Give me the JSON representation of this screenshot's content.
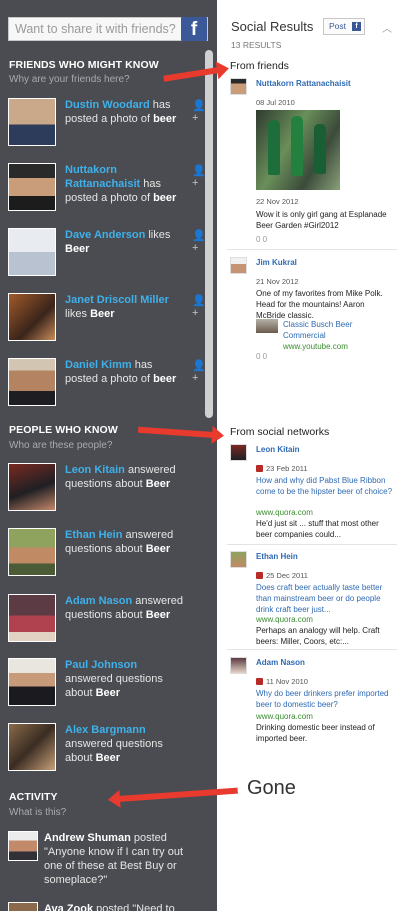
{
  "left": {
    "share_placeholder": "Want to share it with friends?",
    "fb_glyph": "f",
    "friends_title": "FRIENDS WHO MIGHT KNOW",
    "friends_sub": "Why are your friends here?",
    "friends": [
      {
        "name": "Dustin Woodard",
        "action": " has posted a photo of ",
        "topic": "beer",
        "img_color": "#5f7a4a"
      },
      {
        "name": "Nuttakorn Rattanachaisit",
        "action": " has posted a photo of ",
        "topic": "beer",
        "img_color": "#3b3d3d"
      },
      {
        "name": "Dave Anderson",
        "action": " likes ",
        "topic": "Beer",
        "img_color": "#d7dbe0"
      },
      {
        "name": "Janet Driscoll Miller",
        "action": " likes ",
        "topic": "Beer",
        "img_color": "#7a5d3b"
      },
      {
        "name": "Daniel Kimm",
        "action": " has posted a photo of ",
        "topic": "beer",
        "img_color": "#8b7e6a"
      }
    ],
    "people_title": "PEOPLE WHO KNOW",
    "people_sub": "Who are these people?",
    "people": [
      {
        "name": "Leon Kitain",
        "action": " answered questions about ",
        "topic": "Beer",
        "img_color": "#6b3d2e"
      },
      {
        "name": "Ethan Hein",
        "action": " answered questions about ",
        "topic": "Beer",
        "img_color": "#7e8a52"
      },
      {
        "name": "Adam Nason",
        "action": " answered questions about ",
        "topic": "Beer",
        "img_color": "#8a3340"
      },
      {
        "name": "Paul Johnson",
        "action": " answered questions about ",
        "topic": "Beer",
        "img_color": "#2e2e33"
      },
      {
        "name": "Alex Bargmann",
        "action": " answered questions about ",
        "topic": "Beer",
        "img_color": "#6a5440"
      }
    ],
    "activity_title": "ACTIVITY",
    "activity_sub": "What is this?",
    "activity": [
      {
        "name": "Andrew Shuman",
        "text": " posted \"Anyone know if I can try out one of these at Best Buy or someplace?\""
      },
      {
        "name": "Ava Zook",
        "text": " posted \"Need to"
      }
    ]
  },
  "right": {
    "title": "Social Results",
    "count": "13 RESULTS",
    "post_label": "Post",
    "from_friends": "From friends",
    "friend_cards": [
      {
        "name": "Nuttakorn Rattanachaisit",
        "date": "08 Jul 2010",
        "photo_date": "22 Nov 2012",
        "text": "Wow it is only girl gang at Esplanade Beer Garden #Girl2012",
        "counts": "0  0"
      },
      {
        "name": "Jim Kukral",
        "date": "21 Nov 2012",
        "text": "One of my favorites from Mike Polk. Head for the mountains! Aaron McBride classic.",
        "link": "Classic Busch Beer Commercial",
        "url": "www.youtube.com",
        "counts": "0  0"
      }
    ],
    "from_networks": "From social networks",
    "network_cards": [
      {
        "name": "Leon Kitain",
        "date": "23 Feb 2011",
        "question": "How and why did Pabst Blue Ribbon come to be the hipster beer of choice?",
        "url": "www.quora.com",
        "snippet": "He'd just sit ... stuff that most other beer companies could..."
      },
      {
        "name": "Ethan Hein",
        "date": "25 Dec 2011",
        "question": "Does craft beer actually taste better than mainstream beer or do people drink craft beer just...",
        "url": "www.quora.com",
        "snippet": "Perhaps an analogy will help. Craft beers: Miller, Coors, etc:..."
      },
      {
        "name": "Adam Nason",
        "date": "11 Nov 2010",
        "question": "Why do beer drinkers prefer imported beer to domestic beer?",
        "url": "www.quora.com",
        "snippet": "Drinking domestic beer instead of imported beer."
      }
    ]
  },
  "annotation": {
    "gone_label": "Gone",
    "arrow_color": "#e83a2d"
  }
}
